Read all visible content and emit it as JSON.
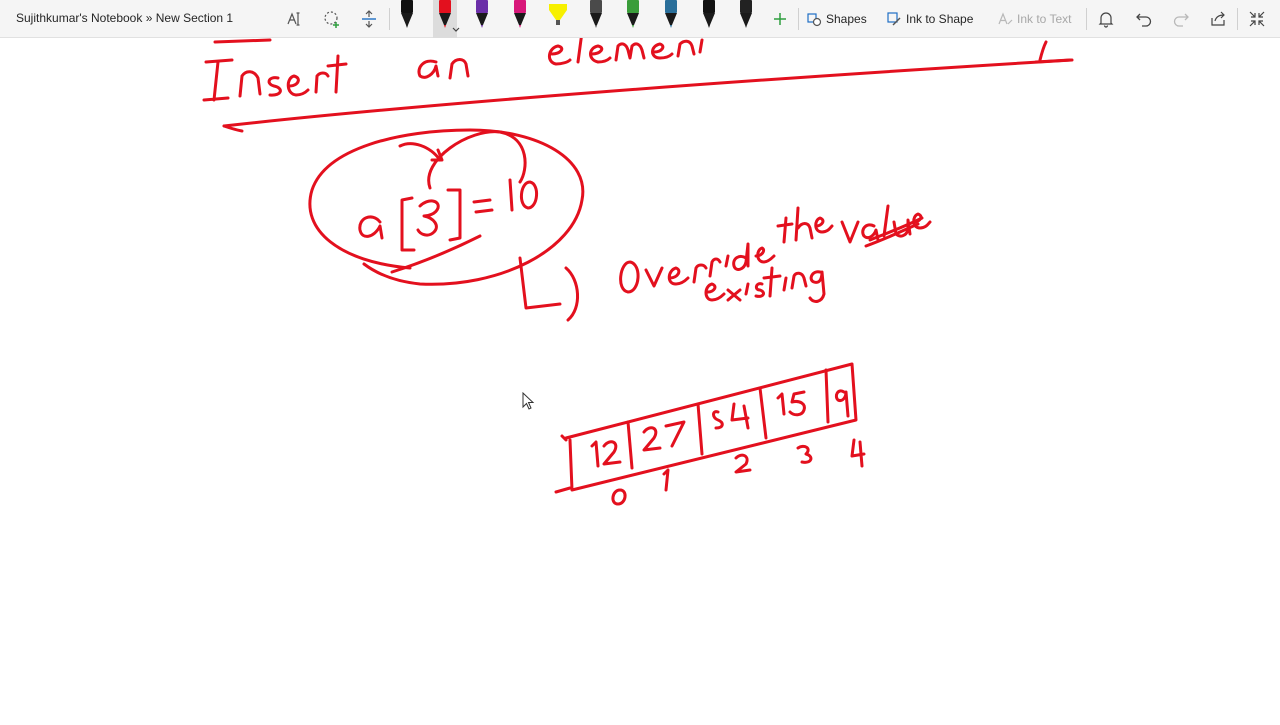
{
  "breadcrumb": {
    "notebook": "Sujithkumar's Notebook",
    "separator": "»",
    "section": "New Section 1"
  },
  "toolbar": {
    "shapes_label": "Shapes",
    "ink_to_shape_label": "Ink to Shape",
    "ink_to_text_label": "Ink to Text",
    "pens": [
      {
        "name": "black-pen",
        "color": "#111111"
      },
      {
        "name": "red-pen",
        "color": "#e3101e",
        "selected": true
      },
      {
        "name": "purple-pen",
        "color": "#6b2fa8"
      },
      {
        "name": "magenta-pen",
        "color": "#d8187a"
      },
      {
        "name": "yellow-highlighter",
        "color": "#f7f000"
      },
      {
        "name": "galaxy-pen",
        "color": "#4a4a4a"
      },
      {
        "name": "rainbow-pen",
        "color": "#3a9d3a"
      },
      {
        "name": "ocean-pen",
        "color": "#2a6f9a"
      },
      {
        "name": "black-pen-2",
        "color": "#111111"
      },
      {
        "name": "gold-pen",
        "color": "#222222"
      }
    ]
  },
  "ink": {
    "color": "#e3101e"
  }
}
